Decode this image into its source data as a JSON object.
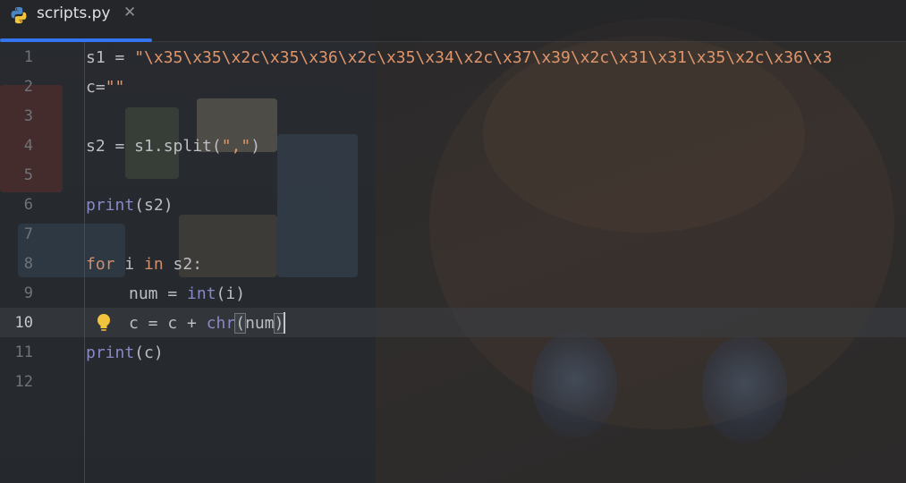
{
  "tab": {
    "icon": "python-file-icon",
    "title": "scripts.py",
    "close_glyph": "✕"
  },
  "editor": {
    "active_line": 10,
    "accent_color": "#3574f0",
    "lines": [
      {
        "number": "1",
        "tokens": [
          {
            "t": "s1 = ",
            "c": "plain"
          },
          {
            "t": "\"\\x35\\x35\\x2c\\x35\\x36\\x2c\\x35\\x34\\x2c\\x37\\x39\\x2c\\x31\\x31\\x35\\x2c\\x36\\x3",
            "c": "str"
          }
        ]
      },
      {
        "number": "2",
        "tokens": [
          {
            "t": "c=",
            "c": "plain"
          },
          {
            "t": "\"\"",
            "c": "str"
          }
        ]
      },
      {
        "number": "3",
        "tokens": []
      },
      {
        "number": "4",
        "tokens": [
          {
            "t": "s2 = s1.split(",
            "c": "plain"
          },
          {
            "t": "\",\"",
            "c": "str"
          },
          {
            "t": ")",
            "c": "plain"
          }
        ]
      },
      {
        "number": "5",
        "tokens": []
      },
      {
        "number": "6",
        "tokens": [
          {
            "t": "print",
            "c": "bi"
          },
          {
            "t": "(s2)",
            "c": "plain"
          }
        ]
      },
      {
        "number": "7",
        "tokens": []
      },
      {
        "number": "8",
        "tokens": [
          {
            "t": "for",
            "c": "kw"
          },
          {
            "t": " i ",
            "c": "plain"
          },
          {
            "t": "in",
            "c": "kw"
          },
          {
            "t": " s2:",
            "c": "plain"
          }
        ]
      },
      {
        "number": "9",
        "indent": true,
        "tokens": [
          {
            "t": "num = ",
            "c": "plain"
          },
          {
            "t": "int",
            "c": "bi"
          },
          {
            "t": "(i)",
            "c": "plain"
          }
        ]
      },
      {
        "number": "10",
        "indent": true,
        "bulb": true,
        "tokens": [
          {
            "t": "c = c + ",
            "c": "plain"
          },
          {
            "t": "chr",
            "c": "bi"
          },
          {
            "t": "(",
            "c": "plain",
            "hl": true
          },
          {
            "t": "num",
            "c": "plain"
          },
          {
            "t": ")",
            "c": "plain",
            "hl": true,
            "caret": true
          }
        ]
      },
      {
        "number": "11",
        "tokens": [
          {
            "t": "print",
            "c": "bi"
          },
          {
            "t": "(c)",
            "c": "plain"
          }
        ]
      },
      {
        "number": "12",
        "tokens": []
      }
    ]
  }
}
